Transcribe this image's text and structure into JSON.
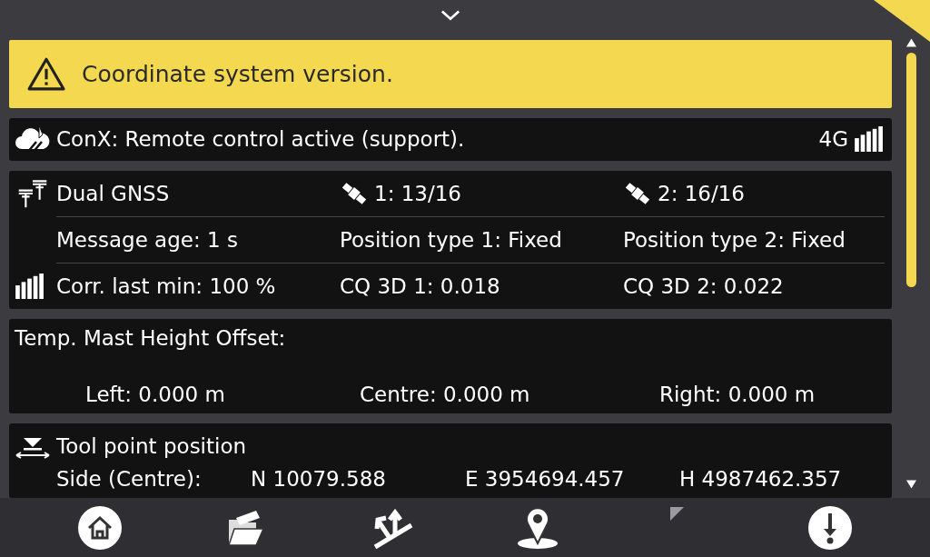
{
  "banner": {
    "text": "Coordinate system version."
  },
  "conx": {
    "text": "ConX: Remote control active (support).",
    "network": "4G"
  },
  "gnss": {
    "rows": [
      [
        "Dual GNSS",
        "1: 13/16",
        "2: 16/16"
      ],
      [
        "Message age: 1 s",
        "Position type 1: Fixed",
        "Position type 2: Fixed"
      ],
      [
        "Corr. last min: 100 %",
        "CQ 3D 1: 0.018",
        "CQ 3D 2: 0.022"
      ]
    ]
  },
  "mast": {
    "title": "Temp. Mast Height Offset:",
    "values": [
      "Left: 0.000 m",
      "Centre: 0.000 m",
      "Right: 0.000 m"
    ]
  },
  "tool_point": {
    "title": "Tool point position",
    "row": [
      "Side (Centre):",
      "N 10079.588",
      "E 3954694.457",
      "H 4987462.357"
    ]
  }
}
